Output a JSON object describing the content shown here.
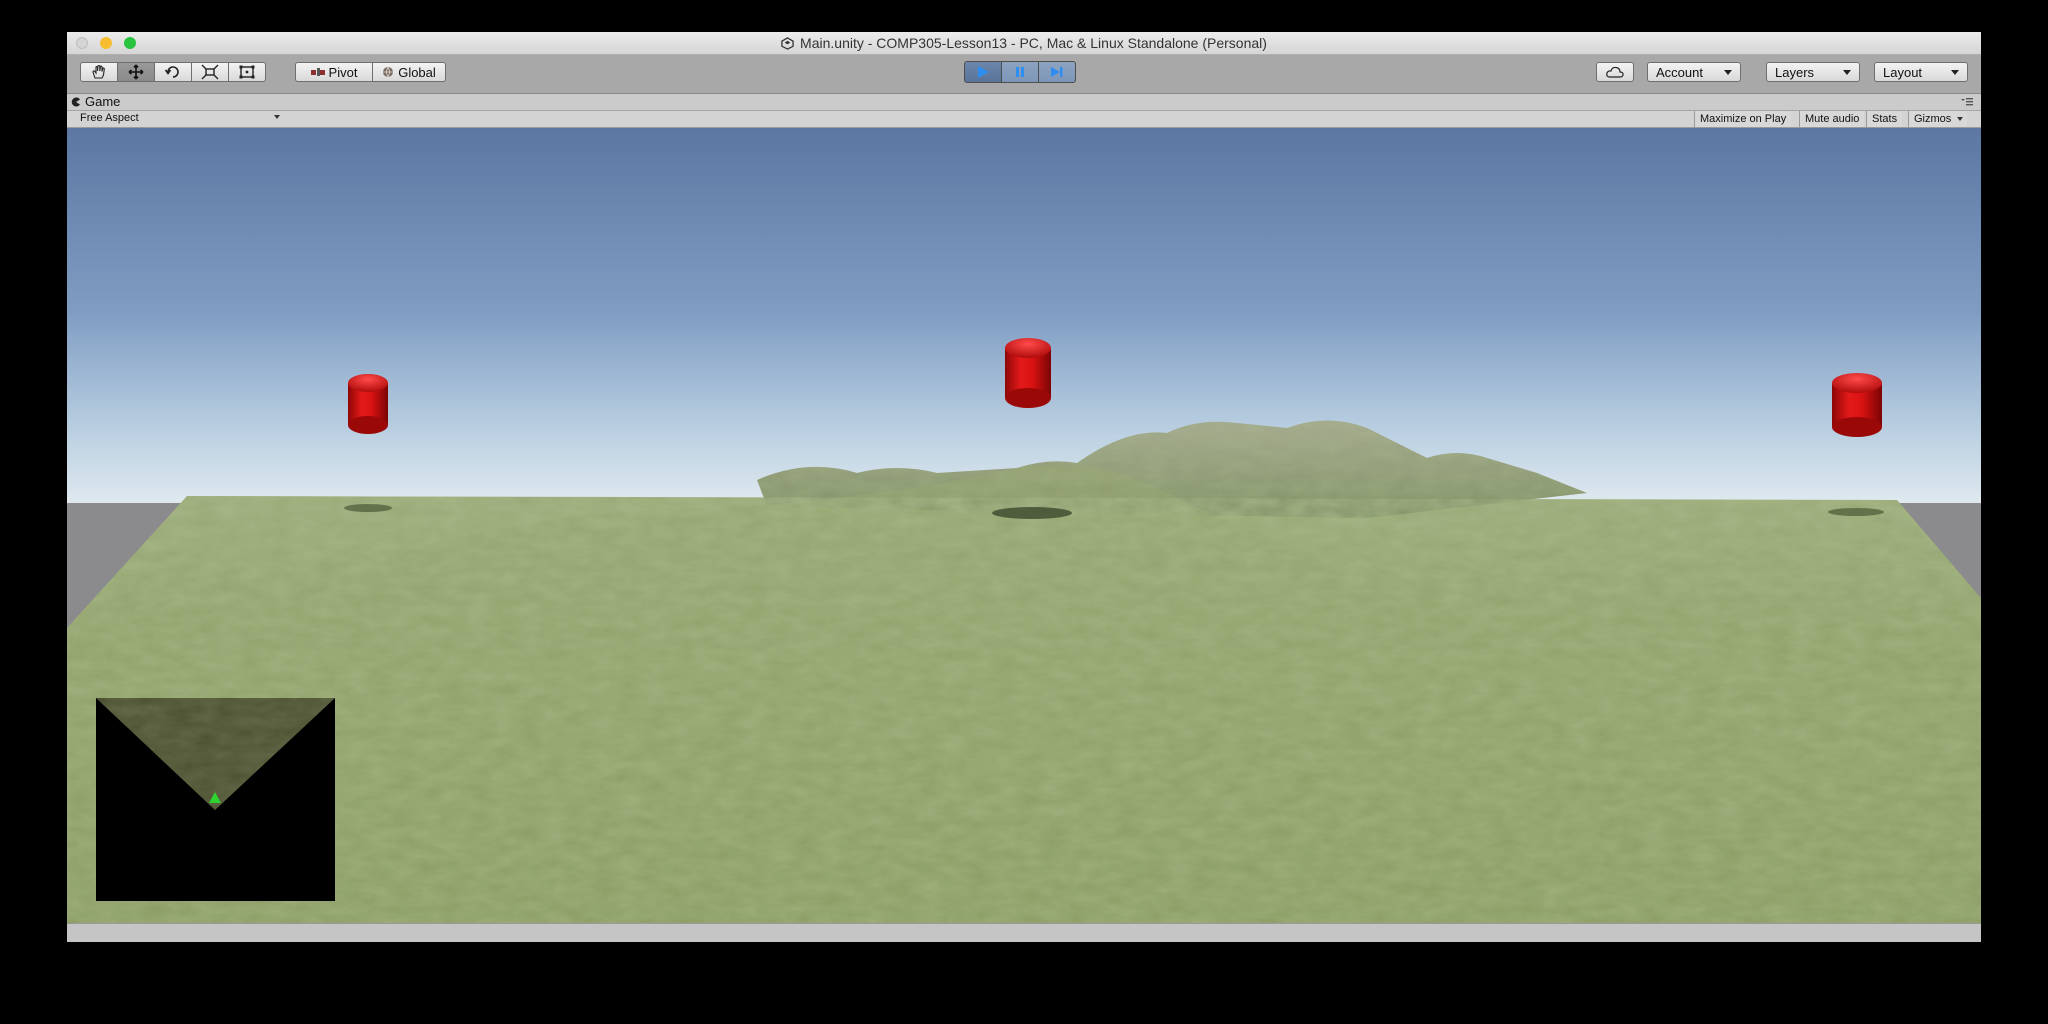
{
  "window": {
    "title": "Main.unity - COMP305-Lesson13 - PC, Mac & Linux Standalone (Personal)"
  },
  "toolbar": {
    "tools": [
      {
        "name": "hand-tool",
        "icon": "hand-icon"
      },
      {
        "name": "move-tool",
        "icon": "move-arrows-icon",
        "active": true
      },
      {
        "name": "rotate-tool",
        "icon": "rotate-icon"
      },
      {
        "name": "scale-tool",
        "icon": "scale-icon"
      },
      {
        "name": "rect-tool",
        "icon": "rect-transform-icon"
      }
    ],
    "pivot_label": "Pivot",
    "global_label": "Global",
    "play_controls": [
      {
        "name": "play",
        "icon": "play-icon",
        "active": true
      },
      {
        "name": "pause",
        "icon": "pause-icon"
      },
      {
        "name": "step",
        "icon": "step-icon"
      }
    ],
    "cloud_icon": "cloud-icon",
    "account_label": "Account",
    "layers_label": "Layers",
    "layout_label": "Layout"
  },
  "game_view": {
    "tab_label": "Game",
    "aspect_label": "Free Aspect",
    "maximize_label": "Maximize on Play",
    "mute_label": "Mute audio",
    "stats_label": "Stats",
    "gizmos_label": "Gizmos"
  },
  "scene": {
    "sky_top_color": "#5d78a3",
    "sky_horizon_color": "#dbe6ee",
    "terrain_color": "#8a9a62",
    "pickup_color": "#d01010",
    "pickup_count": 3,
    "minimap_marker_color": "#2fd32f"
  }
}
